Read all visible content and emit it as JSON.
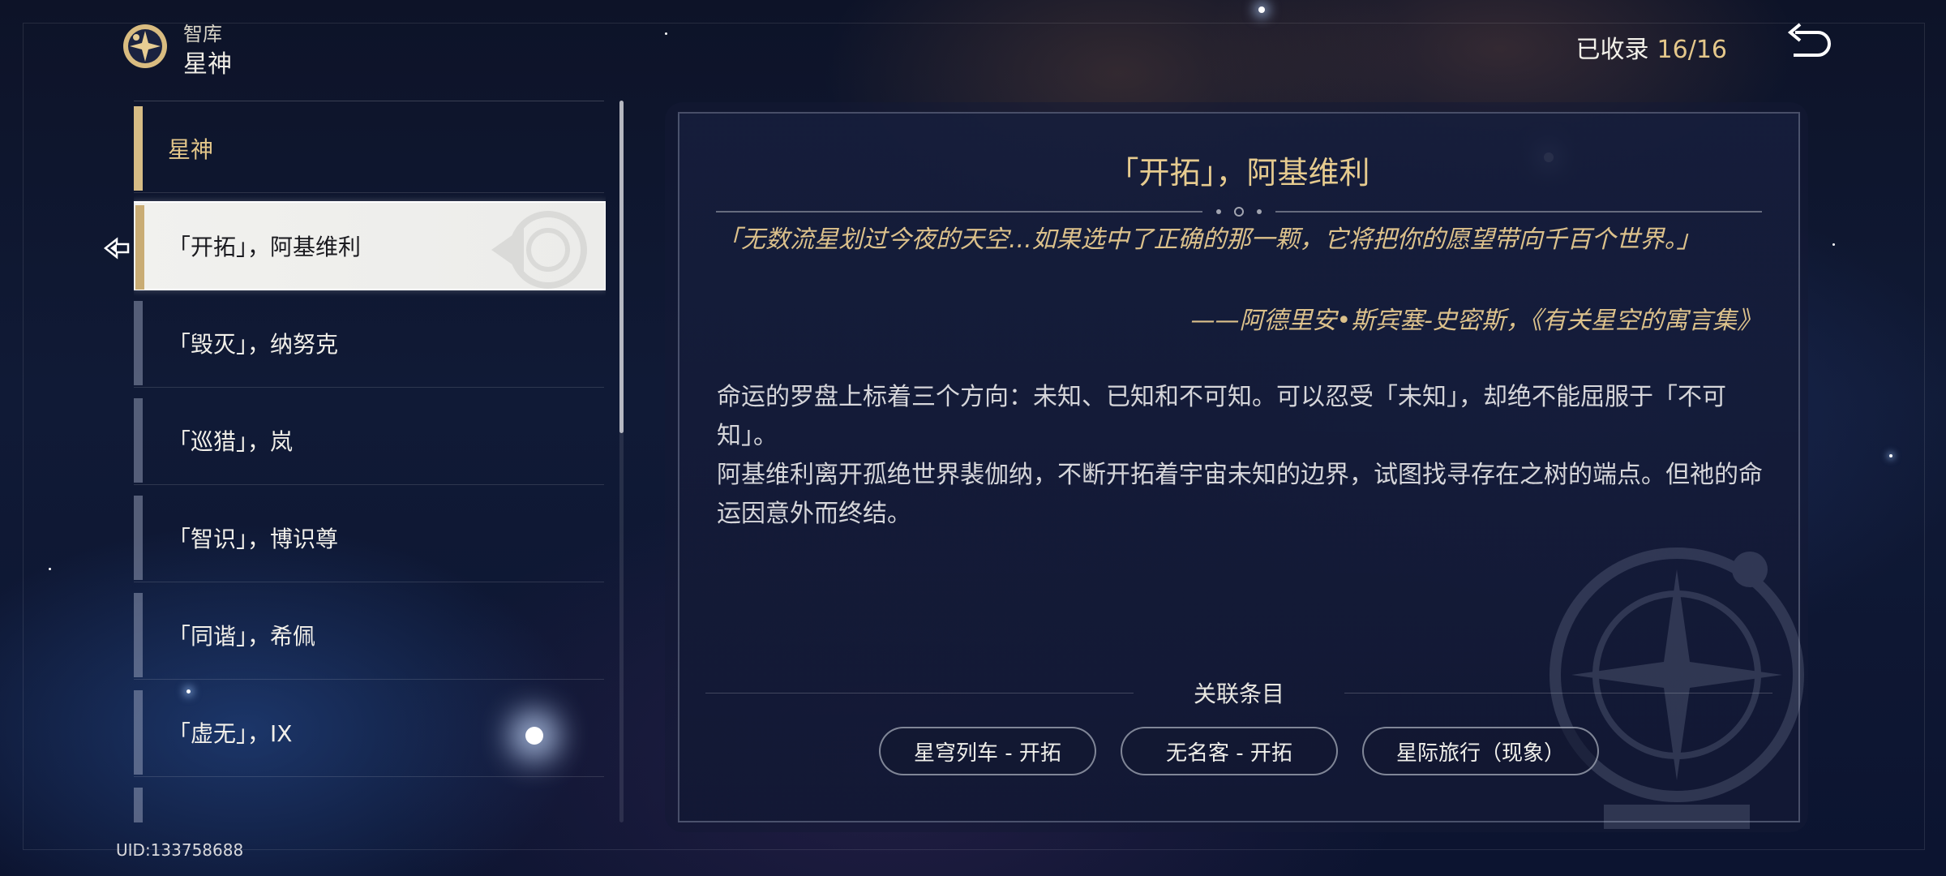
{
  "header": {
    "section_small": "智库",
    "section_title": "星神",
    "collected_label": "已收录",
    "collected_count": "16/16"
  },
  "list": {
    "items": [
      {
        "label": "星神",
        "type": "header"
      },
      {
        "label": "「开拓」，阿基维利",
        "type": "selected"
      },
      {
        "label": "「毁灭」，纳努克",
        "type": "normal"
      },
      {
        "label": "「巡猎」，岚",
        "type": "normal"
      },
      {
        "label": "「智识」，博识尊",
        "type": "normal"
      },
      {
        "label": "「同谐」，希佩",
        "type": "normal"
      },
      {
        "label": "「虚无」，IX",
        "type": "normal"
      },
      {
        "label": "",
        "type": "normal"
      }
    ]
  },
  "detail": {
    "title": "「开拓」，阿基维利",
    "quote": "「无数流星划过今夜的天空...如果选中了正确的那一颗，它将把你的愿望带向千百个世界。」",
    "quote_source": "——阿德里安•斯宾塞-史密斯，《有关星空的寓言集》",
    "body_lines": [
      "命运的罗盘上标着三个方向：未知、已知和不可知。可以忍受「未知」，却绝不能屈服于「不可知」。",
      "阿基维利离开孤绝世界裴伽纳，不断开拓着宇宙未知的边界，试图找寻存在之树的端点。但祂的命运因意外而终结。"
    ],
    "related_label": "关联条目",
    "related": [
      "星穹列车 - 开拓",
      "无名客 - 开拓",
      "星际旅行（现象）"
    ]
  },
  "footer": {
    "uid": "UID:133758688"
  },
  "colors": {
    "accent_gold": "#e4c78a",
    "panel_bg": "#161e3c",
    "selected_bg": "#f1f1ee"
  },
  "icons": [
    "archive-logo-icon",
    "back-arrow-icon",
    "selection-cursor-icon",
    "compass-emblem-icon",
    "trailblaze-emblem-icon"
  ]
}
